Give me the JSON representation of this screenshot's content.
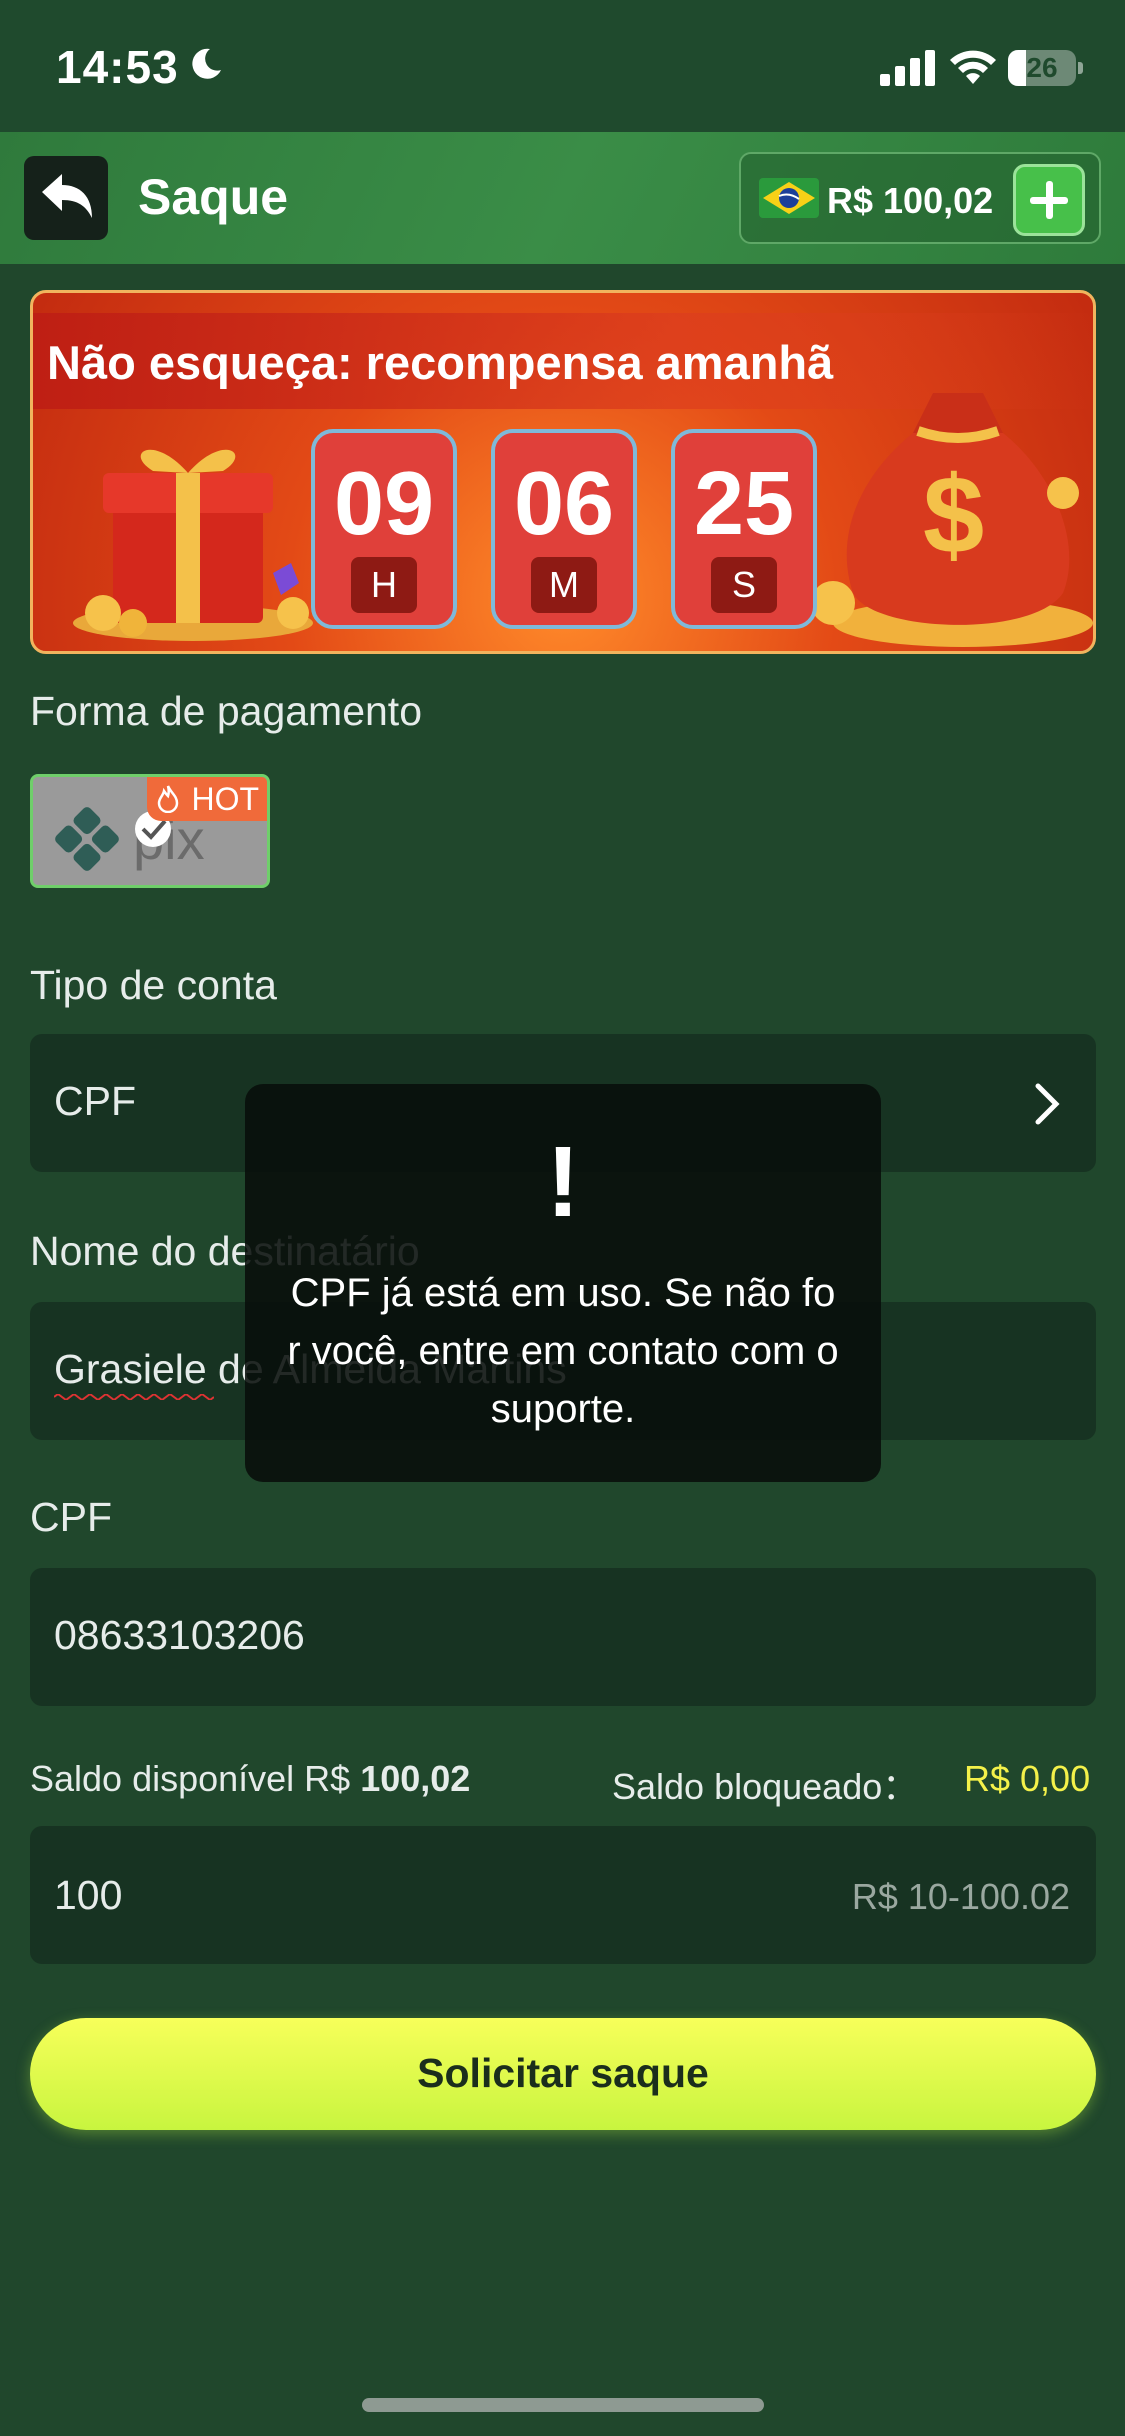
{
  "status_bar": {
    "time": "14:53",
    "battery": "26",
    "battery_level": 0.26
  },
  "header": {
    "title": "Saque",
    "balance": "R$ 100,02",
    "flag": "brazil-flag"
  },
  "banner": {
    "title": "Não esqueça: recompensa amanhã",
    "countdown": [
      {
        "value": "09",
        "unit": "H"
      },
      {
        "value": "06",
        "unit": "M"
      },
      {
        "value": "25",
        "unit": "S"
      }
    ]
  },
  "payment": {
    "label": "Forma de pagamento",
    "method_icon": "pix-logo",
    "badge": "HOT"
  },
  "account_type": {
    "label": "Tipo de conta",
    "value": "CPF"
  },
  "recipient": {
    "label": "Nome do destinatário",
    "value": "Grasiele de Almeida Martins"
  },
  "cpf": {
    "label": "CPF",
    "value": "08633103206"
  },
  "balance_info": {
    "available_label": "Saldo disponível R$",
    "available_value": "100,02",
    "blocked_label": "Saldo bloqueado：",
    "blocked_value": "R$ 0,00"
  },
  "amount": {
    "value": "100",
    "placeholder_range": "R$ 10-100.02"
  },
  "submit": {
    "label": "Solicitar saque"
  },
  "toast": {
    "icon": "!",
    "message": "CPF já está em uso. Se não for você, entre em contato com o suporte."
  },
  "colors": {
    "background": "#20472c",
    "field": "#173322",
    "accent_yellow": "#f3f14a",
    "button": "#e6fb4e"
  }
}
